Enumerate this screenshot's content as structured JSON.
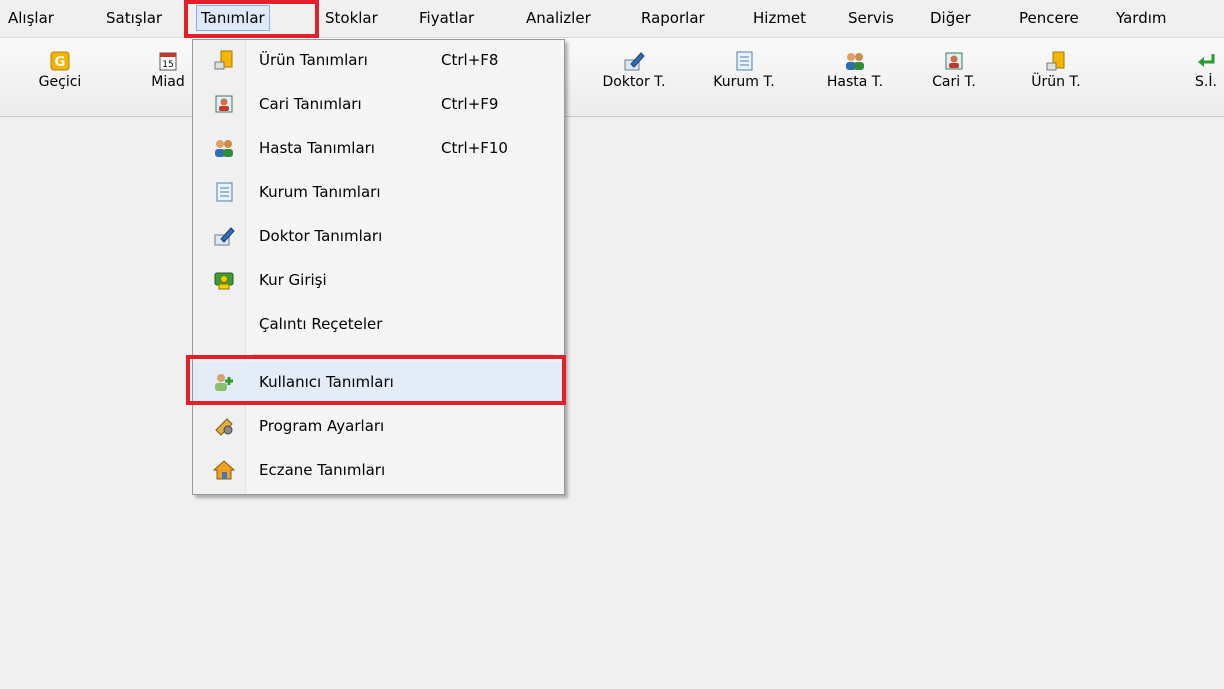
{
  "menubar": {
    "items": [
      {
        "label": "Alışlar"
      },
      {
        "label": "Satışlar"
      },
      {
        "label": "Tanımlar"
      },
      {
        "label": "Stoklar"
      },
      {
        "label": "Fiyatlar"
      },
      {
        "label": "Analizler"
      },
      {
        "label": "Raporlar"
      },
      {
        "label": "Hizmet"
      },
      {
        "label": "Servis"
      },
      {
        "label": "Diğer"
      },
      {
        "label": "Pencere"
      },
      {
        "label": "Yardım"
      }
    ],
    "active": "Tanımlar"
  },
  "toolbar": {
    "buttons": [
      {
        "label": "Geçici",
        "icon": "g-badge-icon"
      },
      {
        "label": "Miad",
        "icon": "calendar-icon"
      },
      {
        "label": "Doktor T.",
        "icon": "doctor-pen-icon"
      },
      {
        "label": "Kurum T.",
        "icon": "document-list-icon"
      },
      {
        "label": "Hasta T.",
        "icon": "people-icon"
      },
      {
        "label": "Cari T.",
        "icon": "contact-card-icon"
      },
      {
        "label": "Ürün T.",
        "icon": "product-stack-icon"
      },
      {
        "label": "S.İ.",
        "icon": "green-return-arrow-icon"
      }
    ]
  },
  "dropdown": {
    "items": [
      {
        "label": "Ürün Tanımları",
        "shortcut": "Ctrl+F8",
        "icon": "product-stack-icon"
      },
      {
        "label": "Cari Tanımları",
        "shortcut": "Ctrl+F9",
        "icon": "contact-card-icon"
      },
      {
        "label": "Hasta Tanımları",
        "shortcut": "Ctrl+F10",
        "icon": "people-icon"
      },
      {
        "label": "Kurum Tanımları",
        "shortcut": "",
        "icon": "document-list-icon"
      },
      {
        "label": "Doktor Tanımları",
        "shortcut": "",
        "icon": "doctor-pen-icon"
      },
      {
        "label": "Kur Girişi",
        "shortcut": "",
        "icon": "money-exchange-icon"
      },
      {
        "label": "Çalıntı Reçeteler",
        "shortcut": "",
        "icon": ""
      },
      {
        "label": "Kullanıcı Tanımları",
        "shortcut": "",
        "icon": "add-user-icon"
      },
      {
        "label": "Program Ayarları",
        "shortcut": "",
        "icon": "settings-tools-icon"
      },
      {
        "label": "Eczane Tanımları",
        "shortcut": "",
        "icon": "home-icon"
      }
    ],
    "highlighted": "Kullanıcı Tanımları"
  },
  "colors": {
    "highlight_border": "#e3202a",
    "menu_background": "#f5f5f5",
    "hover_background": "#e3ecf7"
  }
}
